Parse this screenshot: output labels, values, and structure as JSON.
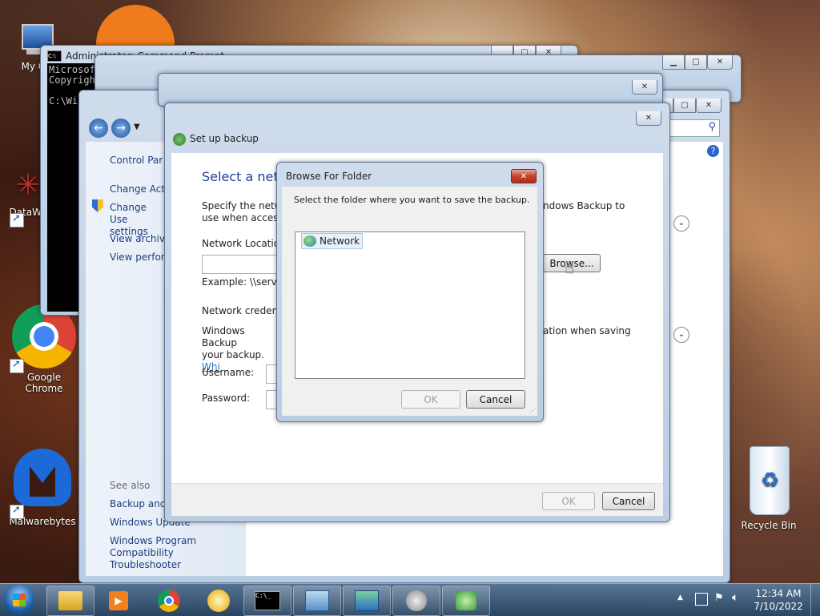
{
  "desktop": {
    "icons": [
      {
        "label": "My Co"
      },
      {
        "label": "DataWa"
      },
      {
        "label": "Google Chrome"
      },
      {
        "label": "Malwarebytes"
      },
      {
        "label": "Recycle Bin"
      }
    ]
  },
  "cmd_window": {
    "title": "Administrator: Command Prompt",
    "lines": [
      "Microsoft",
      "Copyright",
      "",
      "C:\\Wi"
    ]
  },
  "control_panel": {
    "sidebar": {
      "home": "Control Par",
      "items": [
        "Change Act",
        "Change Use settings",
        "View archiv",
        "View perfor"
      ],
      "see_also_heading": "See also",
      "see_also": [
        "Backup and",
        "Windows Update",
        "Windows Program Compatibility Troubleshooter"
      ]
    }
  },
  "setup_backup": {
    "title": "Set up backup",
    "heading": "Select a netw",
    "intro_left": "Specify the netwo",
    "intro_left2": "use when accessin",
    "intro_right": "ndows Backup to",
    "network_location_label": "Network Location",
    "browse_label": "Browse...",
    "example_text": "Example: \\\\server\\",
    "credentials_label": "Network credentia",
    "cred_text_left": "Windows Backup",
    "cred_text_right": "ation when saving",
    "cred_text_left2": "your backup.",
    "cred_link": "Whi",
    "username_label": "Username:",
    "password_label": "Password:",
    "ok_label": "OK",
    "cancel_label": "Cancel"
  },
  "browse_dialog": {
    "title": "Browse For Folder",
    "instruction": "Select the folder where you want to save the backup.",
    "tree_items": [
      "Network"
    ],
    "ok_label": "OK",
    "cancel_label": "Cancel"
  },
  "taskbar": {
    "clock_time": "12:34 AM",
    "clock_date": "7/10/2022"
  }
}
